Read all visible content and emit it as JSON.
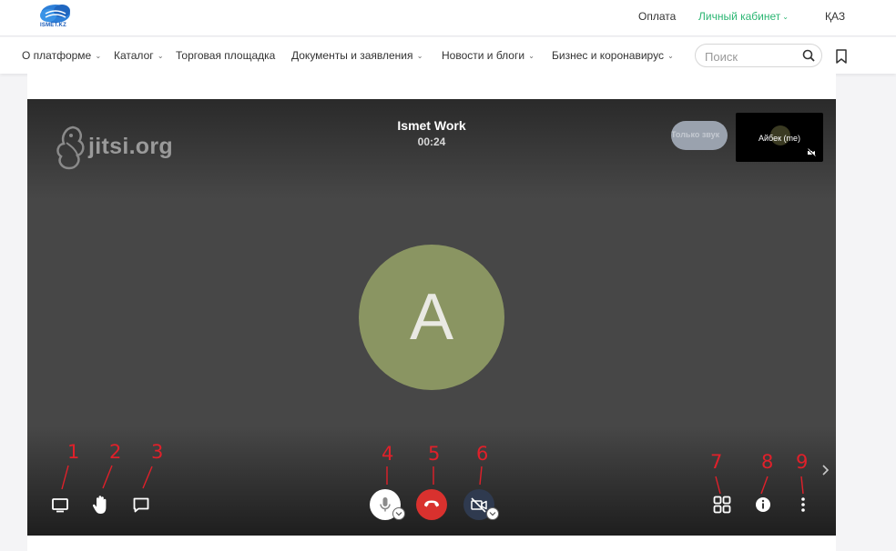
{
  "header": {
    "logo_text": "ISMET.KZ",
    "links": {
      "payment": "Оплата",
      "cabinet": "Личный кабинет",
      "language": "ҚАЗ"
    },
    "accent_color": "#2cb673"
  },
  "nav": {
    "items": [
      {
        "label": "О платформе",
        "dropdown": true
      },
      {
        "label": "Каталог",
        "dropdown": true
      },
      {
        "label": "Торговая площадка",
        "dropdown": false
      },
      {
        "label": "Документы и заявления",
        "dropdown": true
      },
      {
        "label": "Новости и блоги",
        "dropdown": true
      },
      {
        "label": "Бизнес и коронавирус",
        "dropdown": true
      }
    ],
    "search": {
      "placeholder": "Поиск",
      "value": ""
    },
    "icons": {
      "search": "search-icon",
      "bookmark": "bookmark-icon"
    }
  },
  "meeting": {
    "watermark": "jitsi.org",
    "title": "Ismet Work",
    "timer": "00:24",
    "audio_only_label": "Только звук",
    "self_view_label": "Айбек (me)",
    "avatar_letter": "A",
    "avatar_color": "#8a9562",
    "toolbar": {
      "left": [
        "screen-share-icon",
        "raise-hand-icon",
        "chat-icon"
      ],
      "center": [
        "microphone-icon",
        "hangup-icon",
        "camera-off-icon"
      ],
      "right": [
        "tile-view-icon",
        "info-icon",
        "more-options-icon"
      ],
      "hangup_color": "#d9312e"
    }
  },
  "annotations": [
    "1",
    "2",
    "3",
    "4",
    "5",
    "6",
    "7",
    "8",
    "9"
  ],
  "annotation_color": "#e0202a"
}
